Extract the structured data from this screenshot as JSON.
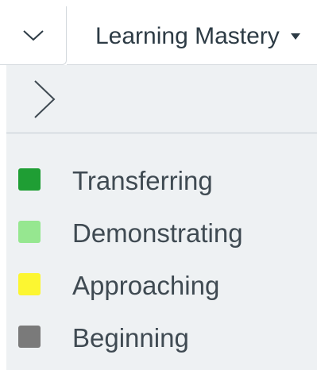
{
  "header": {
    "mastery_select_label": "Learning Mastery"
  },
  "legend": {
    "items": [
      {
        "label": "Transferring",
        "color": "#1f9e34"
      },
      {
        "label": "Demonstrating",
        "color": "#96e790"
      },
      {
        "label": "Approaching",
        "color": "#fcf631"
      },
      {
        "label": "Beginning",
        "color": "#7a7a7a"
      }
    ]
  },
  "icons": {
    "collapse": "chevron-down-icon",
    "expand": "chevron-right-icon",
    "dropdown": "caret-down-icon"
  }
}
